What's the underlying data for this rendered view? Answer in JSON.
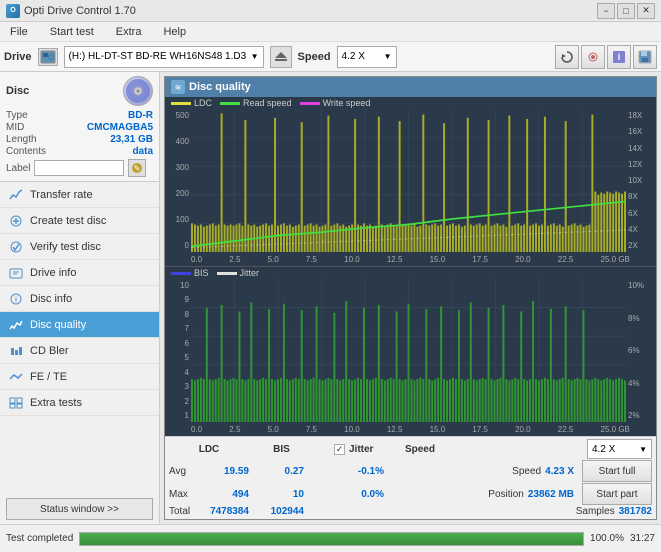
{
  "app": {
    "title": "Opti Drive Control 1.70",
    "minimize_label": "−",
    "maximize_label": "□",
    "close_label": "✕"
  },
  "menu": {
    "items": [
      "File",
      "Start test",
      "Extra",
      "Help"
    ]
  },
  "drive_bar": {
    "label": "Drive",
    "drive_name": "(H:)  HL-DT-ST BD-RE  WH16NS48 1.D3",
    "speed_label": "Speed",
    "speed_value": "4.2 X"
  },
  "disc": {
    "title": "Disc",
    "type_label": "Type",
    "type_value": "BD-R",
    "mid_label": "MID",
    "mid_value": "CMCMAGBA5",
    "length_label": "Length",
    "length_value": "23,31 GB",
    "contents_label": "Contents",
    "contents_value": "data",
    "label_label": "Label"
  },
  "nav": {
    "items": [
      {
        "id": "transfer-rate",
        "label": "Transfer rate"
      },
      {
        "id": "create-test-disc",
        "label": "Create test disc"
      },
      {
        "id": "verify-test-disc",
        "label": "Verify test disc"
      },
      {
        "id": "drive-info",
        "label": "Drive info"
      },
      {
        "id": "disc-info",
        "label": "Disc info"
      },
      {
        "id": "disc-quality",
        "label": "Disc quality",
        "active": true
      },
      {
        "id": "cd-bler",
        "label": "CD Bler"
      },
      {
        "id": "fe-te",
        "label": "FE / TE"
      },
      {
        "id": "extra-tests",
        "label": "Extra tests"
      }
    ]
  },
  "status_window_btn": "Status window >>",
  "status_bar": {
    "status_text": "Test completed",
    "progress": 100,
    "time": "31:27"
  },
  "disc_quality": {
    "panel_title": "Disc quality",
    "chart1": {
      "legend": [
        {
          "label": "LDC",
          "color": "yellow"
        },
        {
          "label": "Read speed",
          "color": "lime"
        },
        {
          "label": "Write speed",
          "color": "magenta"
        }
      ],
      "y_labels_left": [
        "500",
        "400",
        "300",
        "200",
        "100",
        "0"
      ],
      "y_labels_right": [
        "18X",
        "16X",
        "14X",
        "12X",
        "10X",
        "8X",
        "6X",
        "4X",
        "2X"
      ],
      "x_labels": [
        "0.0",
        "2.5",
        "5.0",
        "7.5",
        "10.0",
        "12.5",
        "15.0",
        "17.5",
        "20.0",
        "22.5",
        "25.0 GB"
      ]
    },
    "chart2": {
      "legend": [
        {
          "label": "BIS",
          "color": "cyan"
        },
        {
          "label": "Jitter",
          "color": "white"
        }
      ],
      "y_labels_left": [
        "10",
        "9",
        "8",
        "7",
        "6",
        "5",
        "4",
        "3",
        "2",
        "1"
      ],
      "y_labels_right": [
        "10%",
        "8%",
        "6%",
        "4%",
        "2%"
      ],
      "x_labels": [
        "0.0",
        "2.5",
        "5.0",
        "7.5",
        "10.0",
        "12.5",
        "15.0",
        "17.5",
        "20.0",
        "22.5",
        "25.0 GB"
      ]
    }
  },
  "stats": {
    "headers": [
      "LDC",
      "BIS",
      "",
      "Jitter",
      "Speed",
      ""
    ],
    "avg_label": "Avg",
    "avg_ldc": "19.59",
    "avg_bis": "0.27",
    "avg_jitter": "-0.1%",
    "max_label": "Max",
    "max_ldc": "494",
    "max_bis": "10",
    "max_jitter": "0.0%",
    "total_label": "Total",
    "total_ldc": "7478384",
    "total_bis": "102944",
    "speed_label": "Speed",
    "speed_value": "4.23 X",
    "position_label": "Position",
    "position_value": "23862 MB",
    "samples_label": "Samples",
    "samples_value": "381782",
    "speed_dropdown": "4.2 X",
    "start_full_btn": "Start full",
    "start_part_btn": "Start part",
    "jitter_checked": true,
    "jitter_label": "Jitter"
  }
}
